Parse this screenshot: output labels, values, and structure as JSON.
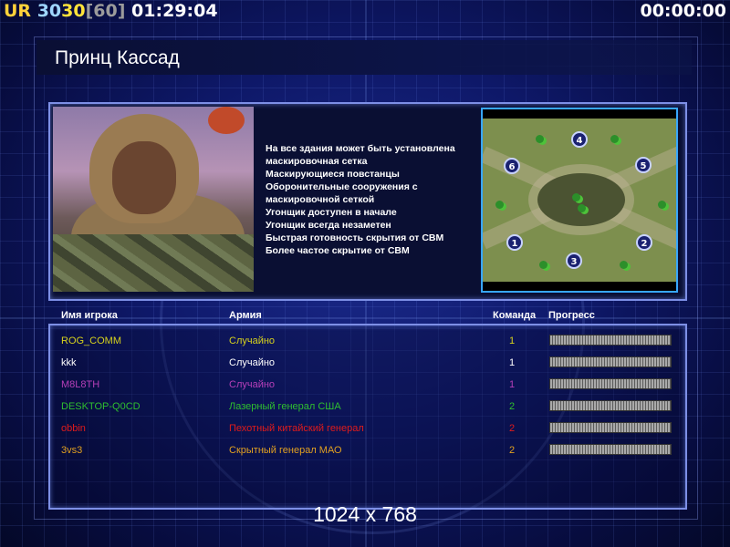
{
  "status": {
    "ur": "UR",
    "num1": "30",
    "num2": "30",
    "num3": "[60]",
    "clock": "01:29:04",
    "timer": "00:00:00"
  },
  "title": "Принц Кассад",
  "description": [
    "На все здания может быть установлена",
    " маскировочная сетка",
    "Маскирующиеся повстанцы",
    "Оборонительные сооружения с",
    " маскировочной сеткой",
    "Угонщик доступен в начале",
    "Угонщик всегда незаметен",
    "Быстрая готовность скрытия от СВМ",
    "Более частое скрытие от СВМ"
  ],
  "minimap": {
    "start_spots": [
      "1",
      "2",
      "3",
      "4",
      "5",
      "6"
    ]
  },
  "table": {
    "headers": {
      "name": "Имя игрока",
      "army": "Армия",
      "team": "Команда",
      "progress": "Прогресс"
    },
    "players": [
      {
        "name": "ROG_COMM",
        "army": "Случайно",
        "team": "1",
        "color": "#d7d21c"
      },
      {
        "name": "kkk",
        "army": "Случайно",
        "team": "1",
        "color": "#ffffff"
      },
      {
        "name": "M8L8TH",
        "army": "Случайно",
        "team": "1",
        "color": "#b63fb8"
      },
      {
        "name": "DESKTOP-Q0CD",
        "army": "Лазерный генерал США",
        "team": "2",
        "color": "#2fbf2f"
      },
      {
        "name": "obbin",
        "army": "Пехотный китайский генерал",
        "team": "2",
        "color": "#e01b1b"
      },
      {
        "name": "3vs3",
        "army": "Скрытный генерал МАО",
        "team": "2",
        "color": "#e0a020"
      }
    ]
  },
  "resolution": "1024 x 768",
  "colors": {
    "background": "#0e1868",
    "panel_border": "#7d8fe6",
    "minimap_border": "#37a7ff"
  }
}
